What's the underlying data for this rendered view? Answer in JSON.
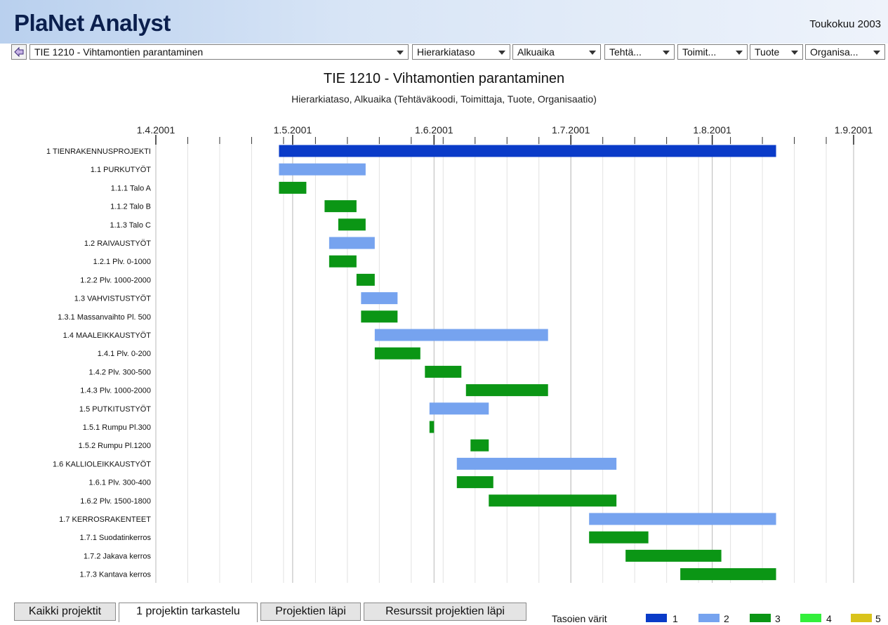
{
  "app": {
    "title": "PlaNet Analyst",
    "date": "Toukokuu 2003"
  },
  "toolbar": {
    "back_icon": "back-arrow-icon",
    "project_select": "TIE 1210 - Vihtamontien parantaminen",
    "dropdowns": [
      "Hierarkiataso",
      "Alkuaika",
      "Tehtä...",
      "Toimit...",
      "Tuote",
      "Organisa..."
    ]
  },
  "chart_data": {
    "type": "gantt",
    "title": "TIE 1210 - Vihtamontien parantaminen",
    "subtitle": "Hierarkiataso, Alkuaika  (Tehtäväkoodi, Toimittaja, Tuote, Organisaatio)",
    "axis_start": "2001-04-01",
    "axis_end": "2001-09-01",
    "major_ticks": [
      {
        "label": "1.4.2001",
        "date": "2001-04-01"
      },
      {
        "label": "1.5.2001",
        "date": "2001-05-01"
      },
      {
        "label": "1.6.2001",
        "date": "2001-06-01"
      },
      {
        "label": "1.7.2001",
        "date": "2001-07-01"
      },
      {
        "label": "1.8.2001",
        "date": "2001-08-01"
      },
      {
        "label": "1.9.2001",
        "date": "2001-09-01"
      }
    ],
    "minor_tick_interval_days": 7,
    "level_colors": {
      "1": "#0a3bc8",
      "2": "#76a3ef",
      "3": "#0b9615",
      "4": "#33ef3b",
      "5": "#d9c31b"
    },
    "tasks": [
      {
        "name": "1 TIENRAKENNUSPROJEKTI",
        "level": 1,
        "start": "2001-04-28",
        "end": "2001-08-15"
      },
      {
        "name": "1.1 PURKUTYÖT",
        "level": 2,
        "start": "2001-04-28",
        "end": "2001-05-17"
      },
      {
        "name": "1.1.1 Talo A",
        "level": 3,
        "start": "2001-04-28",
        "end": "2001-05-04"
      },
      {
        "name": "1.1.2 Talo B",
        "level": 3,
        "start": "2001-05-08",
        "end": "2001-05-15"
      },
      {
        "name": "1.1.3 Talo C",
        "level": 3,
        "start": "2001-05-11",
        "end": "2001-05-17"
      },
      {
        "name": "1.2 RAIVAUSTYÖT",
        "level": 2,
        "start": "2001-05-09",
        "end": "2001-05-19"
      },
      {
        "name": "1.2.1 Plv. 0-1000",
        "level": 3,
        "start": "2001-05-09",
        "end": "2001-05-15"
      },
      {
        "name": "1.2.2 Plv. 1000-2000",
        "level": 3,
        "start": "2001-05-15",
        "end": "2001-05-19"
      },
      {
        "name": "1.3 VAHVISTUSTYÖT",
        "level": 2,
        "start": "2001-05-16",
        "end": "2001-05-24"
      },
      {
        "name": "1.3.1 Massanvaihto Pl. 500",
        "level": 3,
        "start": "2001-05-16",
        "end": "2001-05-24"
      },
      {
        "name": "1.4 MAALEIKKAUSTYÖT",
        "level": 2,
        "start": "2001-05-19",
        "end": "2001-06-26"
      },
      {
        "name": "1.4.1 Plv. 0-200",
        "level": 3,
        "start": "2001-05-19",
        "end": "2001-05-29"
      },
      {
        "name": "1.4.2 Plv. 300-500",
        "level": 3,
        "start": "2001-05-30",
        "end": "2001-06-07"
      },
      {
        "name": "1.4.3 Plv. 1000-2000",
        "level": 3,
        "start": "2001-06-08",
        "end": "2001-06-26"
      },
      {
        "name": "1.5 PUTKITUSTYÖT",
        "level": 2,
        "start": "2001-05-31",
        "end": "2001-06-13"
      },
      {
        "name": "1.5.1 Rumpu Pl.300",
        "level": 3,
        "start": "2001-05-31",
        "end": "2001-06-01"
      },
      {
        "name": "1.5.2 Rumpu Pl.1200",
        "level": 3,
        "start": "2001-06-09",
        "end": "2001-06-13"
      },
      {
        "name": "1.6 KALLIOLEIKKAUSTYÖT",
        "level": 2,
        "start": "2001-06-06",
        "end": "2001-07-11"
      },
      {
        "name": "1.6.1 Plv. 300-400",
        "level": 3,
        "start": "2001-06-06",
        "end": "2001-06-14"
      },
      {
        "name": "1.6.2 Plv. 1500-1800",
        "level": 3,
        "start": "2001-06-13",
        "end": "2001-07-11"
      },
      {
        "name": "1.7 KERROSRAKENTEET",
        "level": 2,
        "start": "2001-07-05",
        "end": "2001-08-15"
      },
      {
        "name": "1.7.1 Suodatinkerros",
        "level": 3,
        "start": "2001-07-05",
        "end": "2001-07-18"
      },
      {
        "name": "1.7.2 Jakava kerros",
        "level": 3,
        "start": "2001-07-13",
        "end": "2001-08-03"
      },
      {
        "name": "1.7.3 Kantava kerros",
        "level": 3,
        "start": "2001-07-25",
        "end": "2001-08-15"
      }
    ]
  },
  "tabs": [
    {
      "label": "Kaikki projektit",
      "active": false
    },
    {
      "label": "1 projektin tarkastelu",
      "active": true
    },
    {
      "label": "Projektien läpi",
      "active": false
    },
    {
      "label": "Resurssit projektien läpi",
      "active": false
    }
  ],
  "legend": {
    "title": "Tasoien värit",
    "items": [
      "1",
      "2",
      "3",
      "4",
      "5"
    ]
  }
}
